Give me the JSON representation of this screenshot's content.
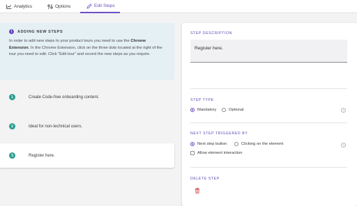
{
  "tabs": [
    {
      "label": "Analytics",
      "icon": "chart-icon"
    },
    {
      "label": "Options",
      "icon": "options-icon"
    },
    {
      "label": "Edit Steps",
      "icon": "pencil-icon",
      "active": true
    }
  ],
  "info": {
    "icon": "info-icon",
    "title": "ADDING NEW STEPS",
    "text_before": "In order to add new steps to your product tours you need to use the ",
    "text_bold": "Chrome Extension",
    "text_after": ". In the Chrome Extension, click on the three dots located at the right of the tour you need to edit. Click \"Edit tour\" and record the new steps as you require."
  },
  "steps": [
    {
      "number": "1",
      "text": "Create Code-free onboarding content."
    },
    {
      "number": "2",
      "text": "Ideal for non-technical users."
    },
    {
      "number": "3",
      "text": "Register here.",
      "selected": true
    }
  ],
  "panel": {
    "description_label": "STEP DESCRIPTION",
    "description_value": "Register here.",
    "step_type_label": "STEP TYPE",
    "step_type_options": [
      "Mandatory",
      "Optional"
    ],
    "step_type_selected": "Mandatory",
    "trigger_label": "NEXT STEP TRIGGERED BY",
    "trigger_options": [
      "Next step button",
      "Clicking on the element"
    ],
    "trigger_selected": "Next step button",
    "allow_interaction_label": "Allow element interaction",
    "allow_interaction_checked": false,
    "delete_label": "DELETE STEP",
    "help_glyph": "?"
  },
  "colors": {
    "accent": "#6d4fc2",
    "step_badge": "#2a9d8f",
    "info_bg": "#e4f0f3",
    "delete": "#d64545"
  }
}
